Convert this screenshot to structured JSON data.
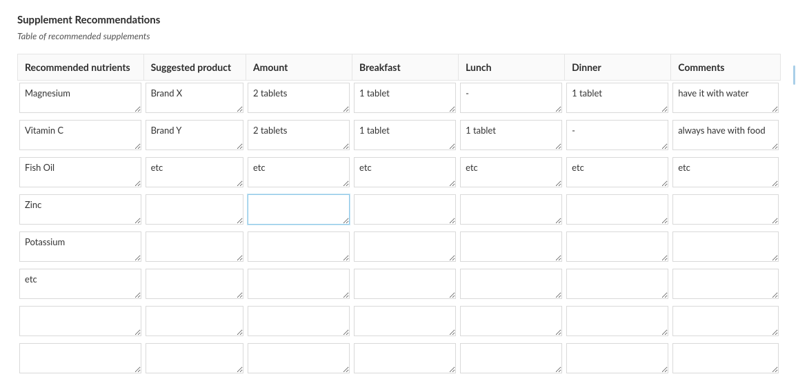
{
  "title": "Supplement Recommendations",
  "subtitle": "Table of recommended supplements",
  "columns": [
    "Recommended nutrients",
    "Suggested product",
    "Amount",
    "Breakfast",
    "Lunch",
    "Dinner",
    "Comments"
  ],
  "rows": [
    [
      "Magnesium",
      "Brand X",
      "2 tablets",
      "1 tablet",
      "-",
      "1 tablet",
      "have it with water"
    ],
    [
      "Vitamin C",
      "Brand Y",
      "2 tablets",
      "1 tablet",
      "1 tablet",
      "-",
      "always have with food"
    ],
    [
      "Fish Oil",
      "etc",
      "etc",
      "etc",
      "etc",
      "etc",
      "etc"
    ],
    [
      "Zinc",
      "",
      "",
      "",
      "",
      "",
      ""
    ],
    [
      "Potassium",
      "",
      "",
      "",
      "",
      "",
      ""
    ],
    [
      "etc",
      "",
      "",
      "",
      "",
      "",
      ""
    ],
    [
      "",
      "",
      "",
      "",
      "",
      "",
      ""
    ],
    [
      "",
      "",
      "",
      "",
      "",
      "",
      ""
    ]
  ],
  "focused_cell": {
    "row": 3,
    "col": 2
  }
}
